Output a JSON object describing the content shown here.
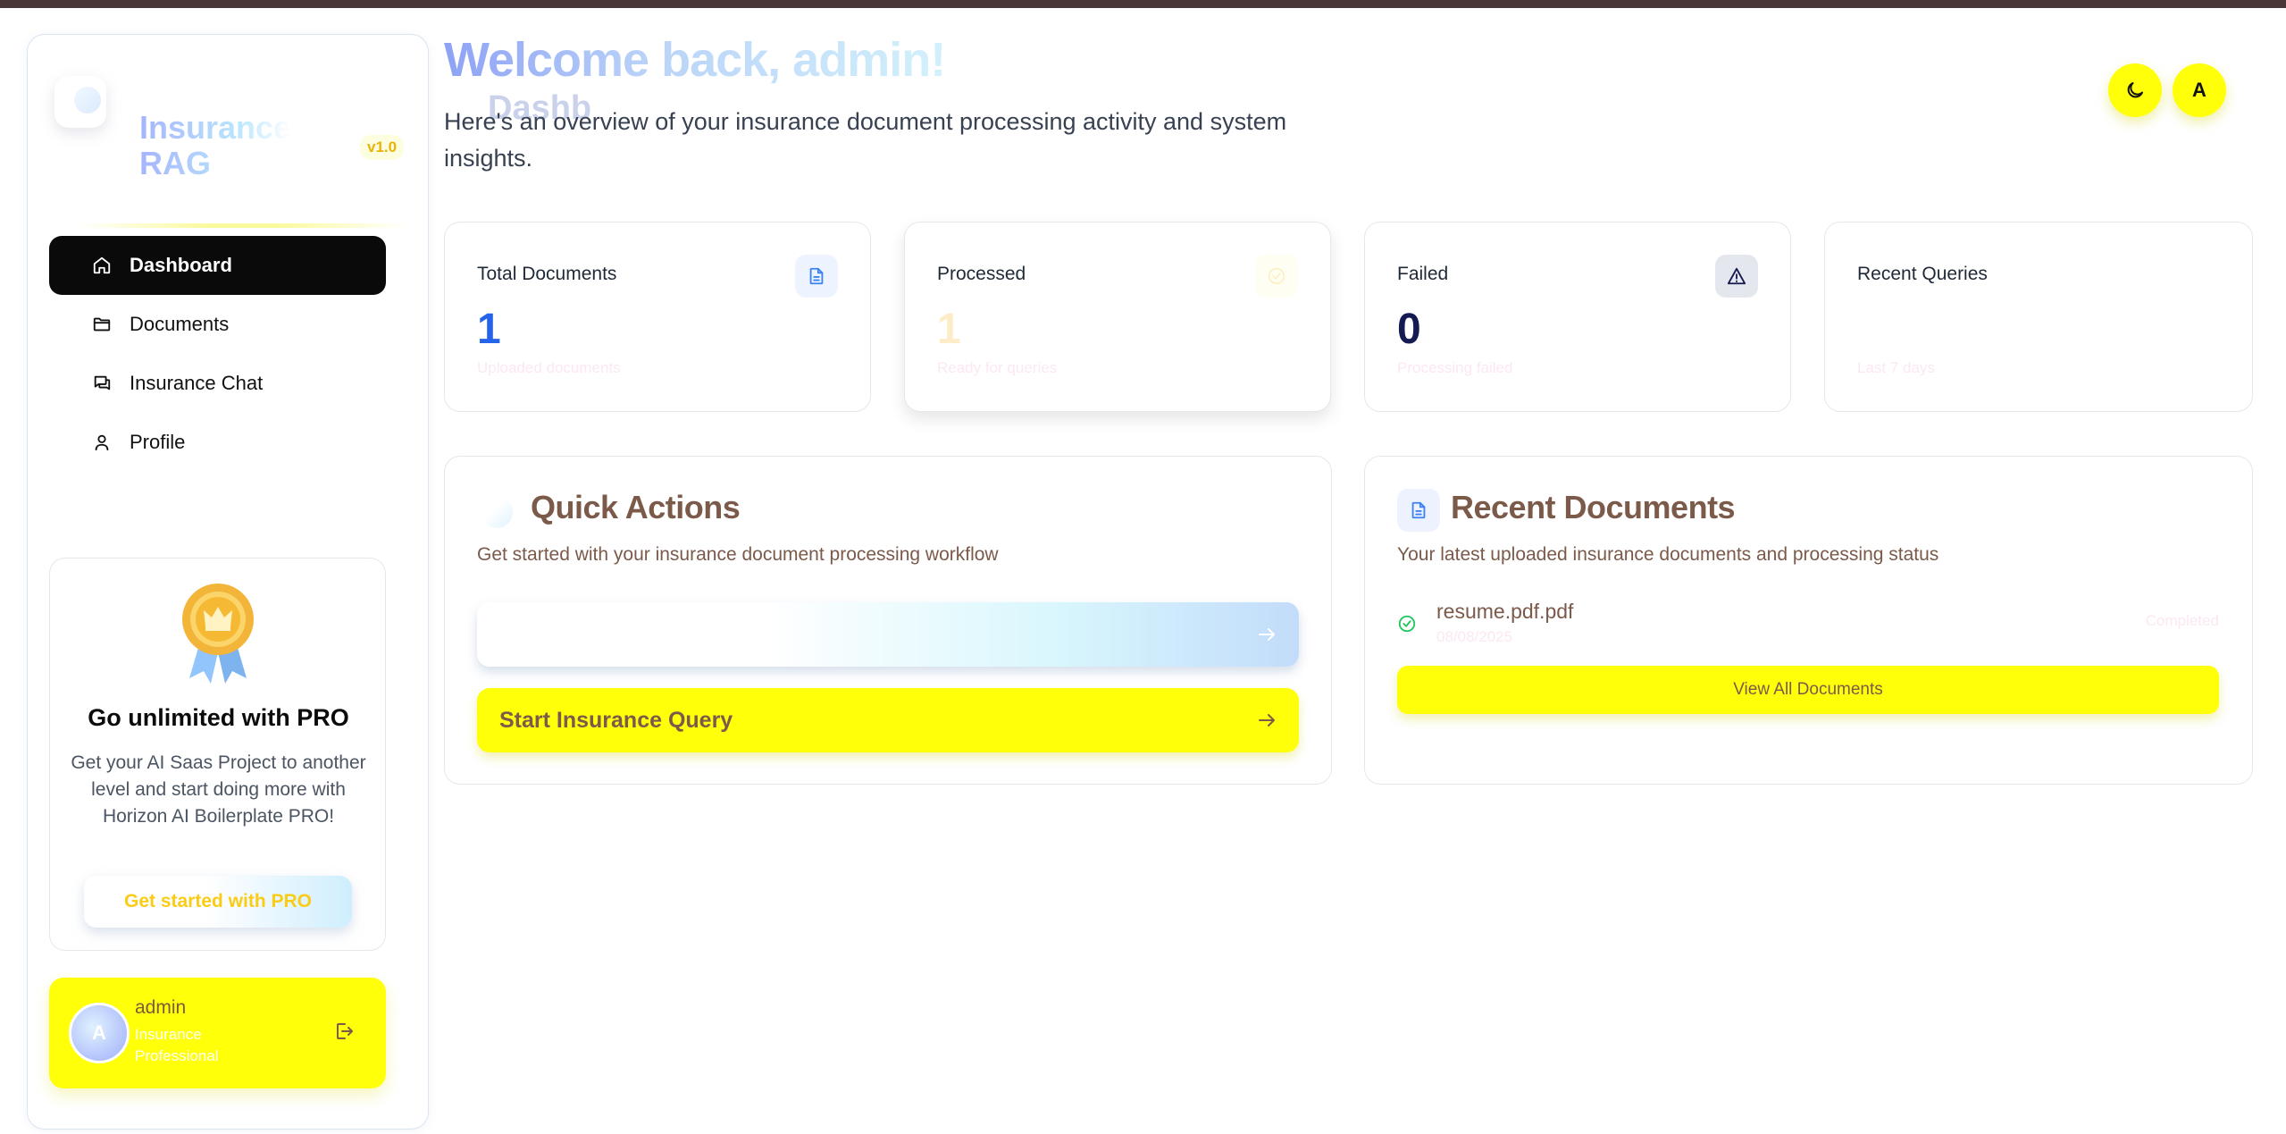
{
  "brand": {
    "name": "Insurance RAG",
    "version": "v1.0"
  },
  "nav": [
    {
      "label": "Dashboard",
      "icon": "home-icon",
      "active": true
    },
    {
      "label": "Documents",
      "icon": "folder-icon",
      "active": false
    },
    {
      "label": "Insurance Chat",
      "icon": "chat-icon",
      "active": false
    },
    {
      "label": "Profile",
      "icon": "user-icon",
      "active": false
    }
  ],
  "promo": {
    "badge_icon": "award-ribbon-icon",
    "title": "Go unlimited with PRO",
    "text": "Get your AI Saas Project to another level and start doing more with Horizon AI Boilerplate PRO!",
    "button_label": "Get started with PRO"
  },
  "user": {
    "avatar_initial": "A",
    "name": "admin",
    "role": "Insurance Professional"
  },
  "header": {
    "welcome": "Welcome back, admin!",
    "ghost": "Dashb",
    "subtitle": "Here's an overview of your insurance document processing activity and system insights.",
    "theme_icon": "moon-icon",
    "account_initial": "A"
  },
  "stats": [
    {
      "title": "Total Documents",
      "value": "1",
      "sub": "Uploaded documents",
      "icon": "file-text-icon",
      "value_color": "#2563eb"
    },
    {
      "title": "Processed",
      "value": "1",
      "sub": "Ready for queries",
      "icon": "check-circle-icon",
      "value_color": "#fdecc8"
    },
    {
      "title": "Failed",
      "value": "0",
      "sub": "Processing failed",
      "icon": "alert-triangle-icon",
      "value_color": "#141a52"
    },
    {
      "title": "Recent Queries",
      "value": "",
      "sub": "Last 7 days",
      "icon": "",
      "value_color": "#111827"
    }
  ],
  "quick_actions": {
    "title": "Quick Actions",
    "description": "Get started with your insurance document processing workflow",
    "button1_label": "",
    "button2_label": "Start Insurance Query"
  },
  "recent_documents": {
    "title": "Recent Documents",
    "description": "Your latest uploaded insurance documents and processing status",
    "items": [
      {
        "name": "resume.pdf.pdf",
        "date": "08/08/2025",
        "status": "Completed"
      }
    ],
    "view_all_label": "View All Documents"
  },
  "colors": {
    "accent": "#ffff0a",
    "brown": "#7b5a4a",
    "nav_active": "#0a0a0a"
  }
}
